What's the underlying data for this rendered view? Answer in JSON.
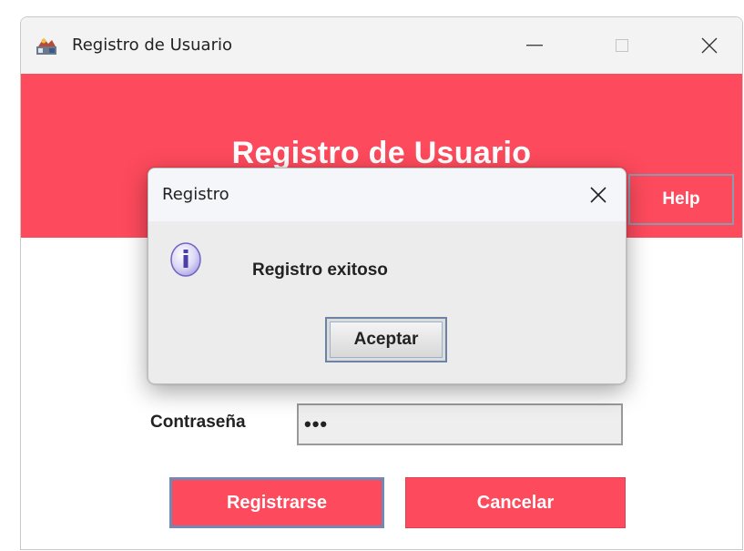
{
  "window": {
    "title": "Registro de Usuario",
    "icon": "java-cup-icon",
    "controls": {
      "minimize": "minimize-icon",
      "maximize": "maximize-icon",
      "close": "close-icon"
    }
  },
  "header": {
    "title": "Registro de Usuario",
    "help_label": "Help",
    "accent_color": "#fd4a5c"
  },
  "form": {
    "password_label": "Contraseña",
    "password_value": "•••"
  },
  "actions": {
    "register_label": "Registrarse",
    "cancel_label": "Cancelar"
  },
  "dialog": {
    "title": "Registro",
    "icon": "info-icon",
    "message": "Registro exitoso",
    "accept_label": "Aceptar"
  }
}
